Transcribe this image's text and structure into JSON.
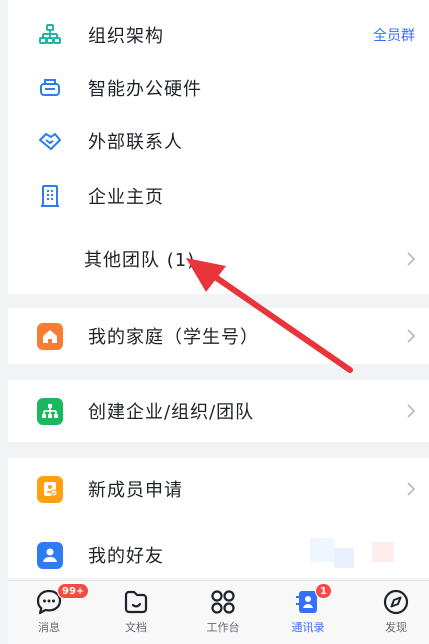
{
  "contacts": {
    "org_structure": {
      "label": "组织架构",
      "action": "全员群",
      "icon": "org-chart-icon"
    },
    "smart_hardware": {
      "label": "智能办公硬件",
      "icon": "printer-icon"
    },
    "external_contacts": {
      "label": "外部联系人",
      "icon": "handshake-icon"
    },
    "company_homepage": {
      "label": "企业主页",
      "icon": "building-icon"
    },
    "other_teams": {
      "label": "其他团队 (1)"
    }
  },
  "home": {
    "label": "我的家庭（学生号）",
    "icon": "house-icon"
  },
  "create": {
    "label": "创建企业/组织/团队",
    "icon": "org-chart-icon"
  },
  "lower": {
    "new_member": {
      "label": "新成员申请",
      "icon": "id-card-icon"
    },
    "friends": {
      "label": "我的好友",
      "icon": "person-icon"
    }
  },
  "tabbar": {
    "tabs": [
      {
        "label": "消息",
        "icon": "chat-icon",
        "badge": "99+"
      },
      {
        "label": "文档",
        "icon": "document-folder-icon"
      },
      {
        "label": "工作台",
        "icon": "grid-apps-icon"
      },
      {
        "label": "通讯录",
        "icon": "contacts-book-icon",
        "badge": "1",
        "active": true
      },
      {
        "label": "发现",
        "icon": "compass-icon"
      }
    ]
  },
  "colors": {
    "accent": "#3370ff",
    "teal": "#24b3a4",
    "orange": "#f77d33",
    "green": "#1ab85f",
    "amber": "#ffa012",
    "blue": "#2d7cf4",
    "badge": "#f54a45",
    "arrow": "#e8353c"
  }
}
